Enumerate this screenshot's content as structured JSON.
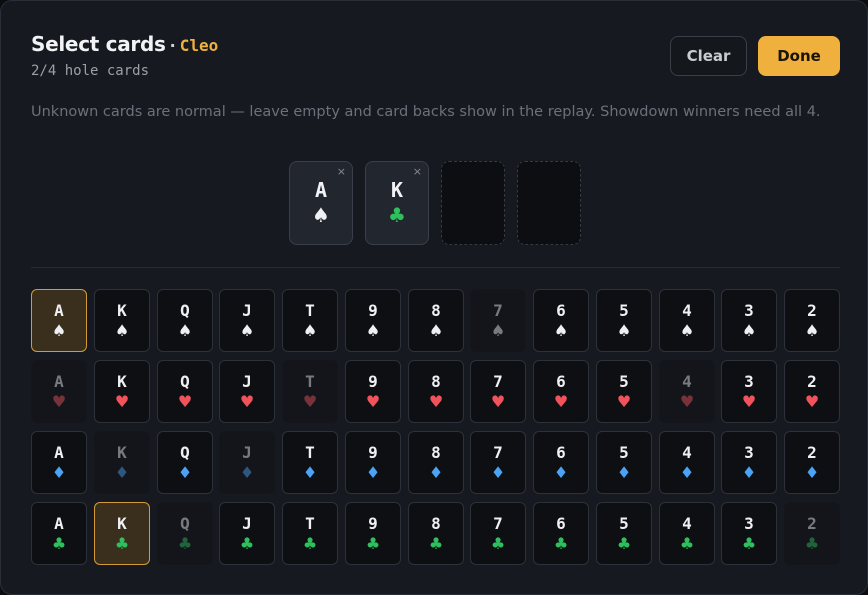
{
  "header": {
    "title": "Select cards",
    "separator": "·",
    "player": "Cleo",
    "subtitle": "2/4 hole cards"
  },
  "buttons": {
    "clear": "Clear",
    "done": "Done"
  },
  "note": "Unknown cards are normal — leave empty and card backs show in the replay. Showdown winners need all 4.",
  "slots": [
    {
      "rank": "A",
      "suit": "♠",
      "suit_class": "spade",
      "remove": "×"
    },
    {
      "rank": "K",
      "suit": "♣",
      "suit_class": "club",
      "remove": "×"
    },
    {
      "rank": "",
      "suit": "",
      "suit_class": "",
      "remove": ""
    },
    {
      "rank": "",
      "suit": "",
      "suit_class": "",
      "remove": ""
    }
  ],
  "ranks": [
    "A",
    "K",
    "Q",
    "J",
    "T",
    "9",
    "8",
    "7",
    "6",
    "5",
    "4",
    "3",
    "2"
  ],
  "suits": [
    {
      "name": "spades",
      "glyph": "♠",
      "cls": "spade",
      "selected": [
        0
      ],
      "dead": [
        7
      ]
    },
    {
      "name": "hearts",
      "glyph": "♥",
      "cls": "heart",
      "selected": [],
      "dead": [
        0,
        4,
        10
      ]
    },
    {
      "name": "diamonds",
      "glyph": "♦",
      "cls": "diamond",
      "selected": [],
      "dead": [
        1,
        3
      ]
    },
    {
      "name": "clubs",
      "glyph": "♣",
      "cls": "club",
      "selected": [
        1
      ],
      "dead": [
        2,
        12
      ]
    }
  ],
  "colors": {
    "accent": "#f0b03e",
    "spade": "#eef0f3",
    "heart": "#f0535c",
    "diamond": "#4aa3f4",
    "club": "#2fbf5e"
  }
}
